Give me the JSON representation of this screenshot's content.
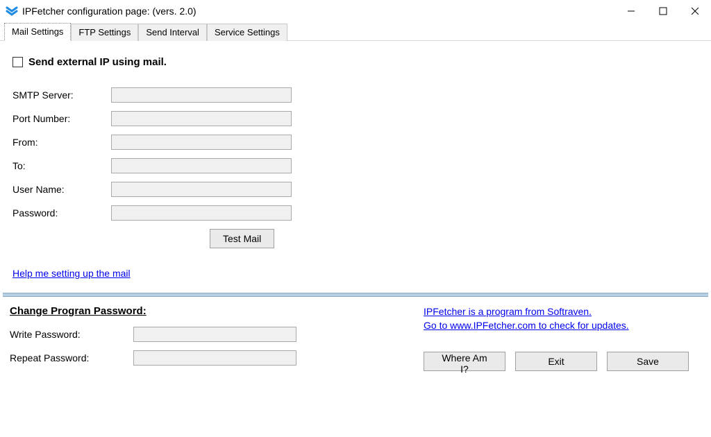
{
  "window": {
    "title": "IPFetcher configuration page: (vers. 2.0)"
  },
  "tabs": {
    "t0": "Mail Settings",
    "t1": "FTP Settings",
    "t2": "Send Interval",
    "t3": "Service Settings"
  },
  "mail": {
    "send_external_label": "Send external IP using mail.",
    "smtp_label": "SMTP Server:",
    "port_label": "Port Number:",
    "from_label": "From:",
    "to_label": "To:",
    "user_label": "User Name:",
    "password_label": "Password:",
    "test_mail_btn": "Test Mail",
    "help_link": "Help me setting up the mail",
    "values": {
      "smtp": "",
      "port": "",
      "from": "",
      "to": "",
      "user": "",
      "password": ""
    }
  },
  "change_pw": {
    "title": "Change Progran Password:",
    "write_label": "Write Password:",
    "repeat_label": "Repeat Password:",
    "values": {
      "write": "",
      "repeat": ""
    }
  },
  "info": {
    "line1": "IPFetcher is a program from Softraven.",
    "line2": "Go to www.IPFetcher.com to check for updates."
  },
  "buttons": {
    "whereami": "Where Am I?",
    "exit": "Exit",
    "save": "Save"
  }
}
